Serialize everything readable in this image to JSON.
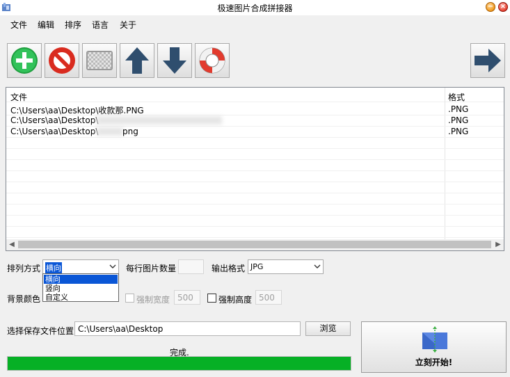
{
  "window": {
    "title": "极速图片合成拼接器"
  },
  "menu": [
    "文件",
    "编辑",
    "排序",
    "语言",
    "关于"
  ],
  "toolbar": {
    "icons": [
      "add-icon",
      "no-entry-icon",
      "checkerboard-icon",
      "arrow-up-icon",
      "arrow-down-icon",
      "lifebuoy-icon",
      "arrow-right-icon"
    ]
  },
  "file_list": {
    "columns": [
      "文件",
      "格式"
    ],
    "rows": [
      {
        "path": "C:\\Users\\aa\\Desktop\\收款那.PNG",
        "format": ".PNG"
      },
      {
        "path": "C:\\Users\\aa\\Desktop\\",
        "format": ".PNG"
      },
      {
        "path": "C:\\Users\\aa\\Desktop\\",
        "path_tail": "png",
        "format": ".PNG"
      }
    ]
  },
  "options": {
    "arrange_label": "排列方式",
    "arrange_value": "横向",
    "arrange_options": [
      "横向",
      "竖向",
      "自定义"
    ],
    "per_row_label": "每行图片数量",
    "per_row_value": "",
    "output_format_label": "输出格式",
    "output_format_value": "JPG",
    "bg_color_label": "背景颜色",
    "force_width_label": "强制宽度",
    "force_width_value": "500",
    "force_height_label": "强制高度",
    "force_height_value": "500"
  },
  "save": {
    "label": "选择保存文件位置",
    "path": "C:\\Users\\aa\\Desktop",
    "browse_label": "浏览"
  },
  "status": {
    "text": "完成.",
    "progress": 1.0
  },
  "start": {
    "label": "立刻开始!"
  },
  "colors": {
    "progress": "#06b025",
    "selection": "#0a56d6"
  }
}
